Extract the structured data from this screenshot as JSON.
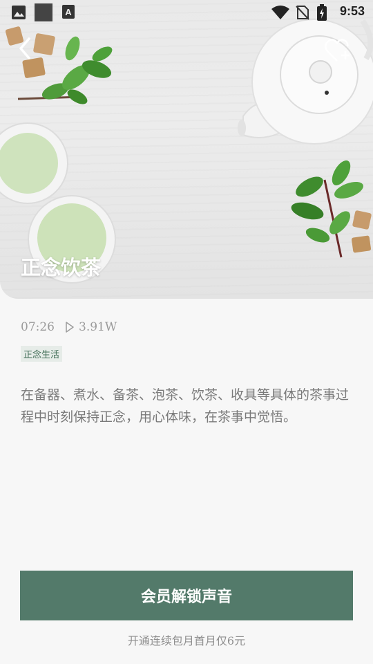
{
  "status_bar": {
    "time": "9:53",
    "icons": [
      "image-icon",
      "app-square-icon",
      "text-a-icon",
      "wifi-icon",
      "no-sim-icon",
      "battery-charging-icon"
    ]
  },
  "hero": {
    "title": "正念饮茶",
    "back_icon": "chevron-left-icon",
    "favorite_icon": "heart-plus-icon"
  },
  "meta": {
    "duration": "07:26",
    "plays": "3.91W",
    "tag": "正念生活"
  },
  "description": "在备器、煮水、备茶、泡茶、饮茶、收具等具体的茶事过程中时刻保持正念，用心体味，在茶事中觉悟。",
  "cta": {
    "label": "会员解锁声音",
    "promo": "开通连续包月首月仅6元"
  },
  "colors": {
    "accent": "#537a6a",
    "tag_bg": "#e6ece8",
    "tag_text": "#3e6b54",
    "background": "#f7f7f7"
  }
}
